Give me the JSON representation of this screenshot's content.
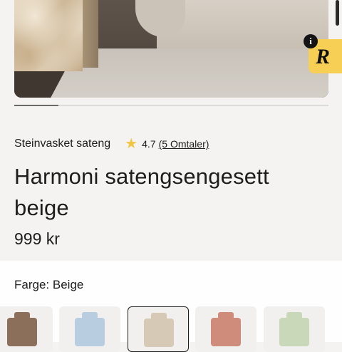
{
  "gallery": {
    "image_alt": "Harmoni satengsengesett beige",
    "active_slide": 1,
    "slide_count": 7
  },
  "badges": {
    "info_icon": "i",
    "r_badge": "R"
  },
  "product": {
    "collection": "Steinvasket sateng",
    "rating": "4.7",
    "reviews_label": "(5 Omtaler)",
    "title": "Harmoni satengsengesett beige",
    "price": "999 kr"
  },
  "color_selector": {
    "label": "Farge:",
    "selected": "Beige",
    "swatches": [
      {
        "name": "Brun",
        "color": "#8b6f5b"
      },
      {
        "name": "Blå",
        "color": "#b9cde0"
      },
      {
        "name": "Beige",
        "color": "#d6c9b5"
      },
      {
        "name": "Rosa",
        "color": "#cf8c7b"
      },
      {
        "name": "Grønn",
        "color": "#c9d8b8"
      }
    ]
  },
  "colors": {
    "background": "#f4f3f2",
    "star": "#f0c540",
    "badge_yellow": "#f8cf55",
    "text": "#1d1d1d"
  }
}
